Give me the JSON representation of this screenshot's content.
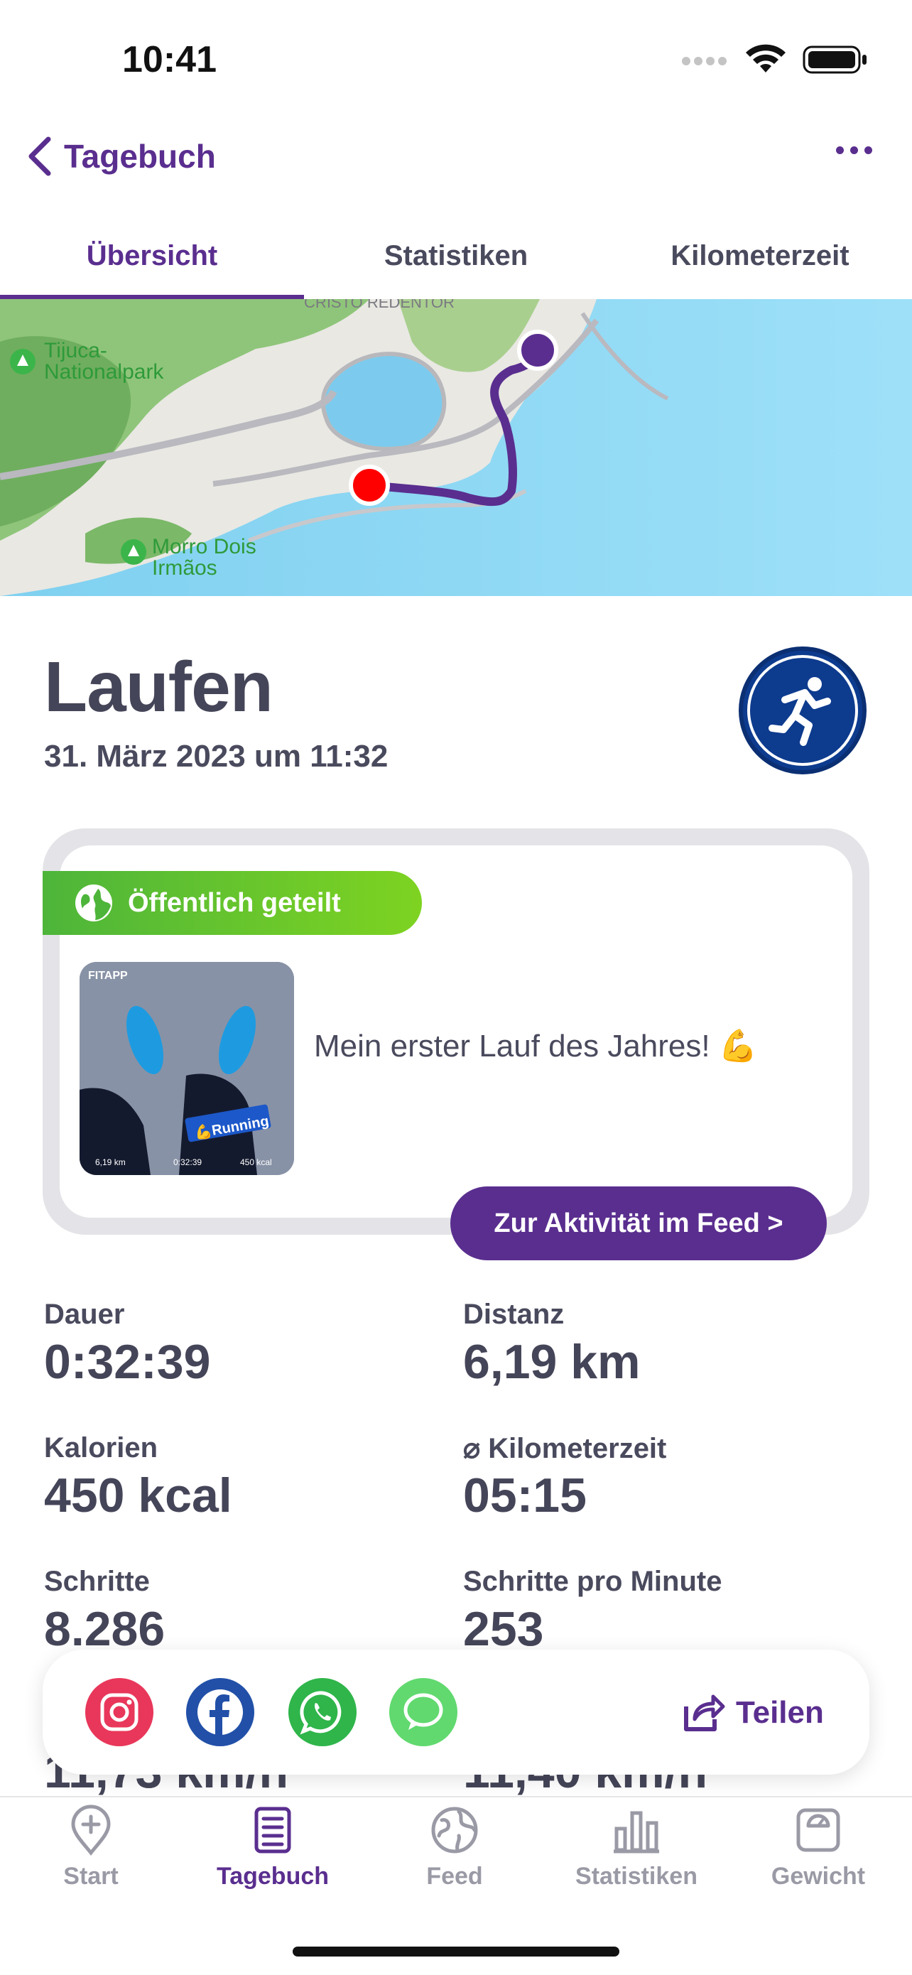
{
  "status": {
    "time": "10:41"
  },
  "nav": {
    "back_label": "Tagebuch"
  },
  "tabs": [
    {
      "label": "Übersicht",
      "active": true
    },
    {
      "label": "Statistiken",
      "active": false
    },
    {
      "label": "Kilometerzeit",
      "active": false
    }
  ],
  "map": {
    "labels": {
      "landmark": "CRISTO REDENTOR",
      "park1": "Tijuca-",
      "park2": "Nationalpark",
      "morro1": "Morro Dois",
      "morro2": "Irmãos"
    }
  },
  "activity": {
    "title": "Laufen",
    "date": "31. März 2023 um 11:32"
  },
  "post": {
    "badge": "Öffentlich geteilt",
    "text": "Mein erster Lauf des Jahres! 💪",
    "feed_button": "Zur Aktivität im Feed >",
    "thumb": {
      "brand": "FITAPP",
      "tag": "💪Running",
      "distance": "6,19 km",
      "time": "0:32:39",
      "kcal": "450 kcal"
    }
  },
  "stats": [
    {
      "label": "Dauer",
      "value": "0:32:39"
    },
    {
      "label": "Distanz",
      "value": "6,19 km"
    },
    {
      "label": "Kalorien",
      "value": "450 kcal"
    },
    {
      "label": "⌀ Kilometerzeit",
      "value": "05:15"
    },
    {
      "label": "Schritte",
      "value": "8.286"
    },
    {
      "label": "Schritte pro Minute",
      "value": "253"
    },
    {
      "label": "",
      "value": "11,73 km/h"
    },
    {
      "label": "",
      "value": "11,40 km/h"
    }
  ],
  "share": {
    "label": "Teilen"
  },
  "tabbar": [
    {
      "label": "Start",
      "icon": "pin-plus-icon"
    },
    {
      "label": "Tagebuch",
      "icon": "diary-icon",
      "active": true
    },
    {
      "label": "Feed",
      "icon": "globe-icon"
    },
    {
      "label": "Statistiken",
      "icon": "bar-chart-icon"
    },
    {
      "label": "Gewicht",
      "icon": "scale-icon"
    }
  ],
  "colors": {
    "accent": "#5a2e8f",
    "badge_green": "#6cc72b",
    "route_start": "#ff0000"
  }
}
